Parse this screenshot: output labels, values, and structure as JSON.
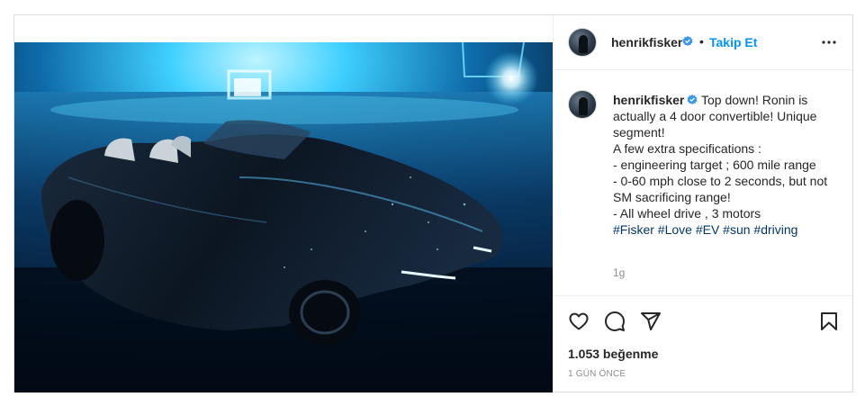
{
  "post": {
    "author": {
      "username": "henrikfisker",
      "verified": true,
      "avatar": "profile-photo"
    },
    "follow_label": "Takip Et",
    "separator": "•",
    "media": {
      "alt": "dark convertible car on wet cobblestone with blue lights",
      "colors": {
        "glow": "#3fd0ff",
        "deep": "#04101e",
        "car": "#0c1622"
      }
    },
    "caption": {
      "username": "henrikfisker",
      "text": "Top down! Ronin is actually a 4 door convertible! Unique segment!\nA few extra specifications :\n- engineering target ; 600 mile range\n- 0-60 mph close to 2 seconds, but not SM sacrificing range!\n- All wheel drive , 3 motors",
      "hashtags": "#Fisker #Love #EV #sun #driving",
      "time": "1g"
    },
    "actions": {
      "like_icon": "heart-icon",
      "comment_icon": "comment-icon",
      "share_icon": "paper-plane-icon",
      "save_icon": "bookmark-icon"
    },
    "likes_text": "1.053 beğenme",
    "time_ago": "1 GÜN ÖNCE"
  },
  "theme": {
    "text": "#262626",
    "link": "#0095f6",
    "hashtag": "#00376b",
    "muted": "#8e8e8e",
    "border": "#dbdbdb"
  }
}
